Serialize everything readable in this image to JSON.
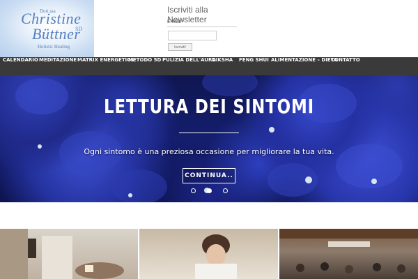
{
  "logo": {
    "title_prefix": "Dott.ssa",
    "name_line1": "Christine",
    "name_line2": "Büttner",
    "suffix": "SD",
    "tagline": "Holistic Healing"
  },
  "newsletter": {
    "title": "Iscriviti alla Newsletter",
    "email_label": "E-Mail *",
    "email_value": "",
    "submit_label": "Iscriviti!"
  },
  "nav": {
    "items": [
      "CALENDARIO",
      "MEDITAZIONE",
      "MATRIX ENERGETICS",
      "METODO 5D",
      "PULIZIA DELL'AURA",
      "DIKSHA",
      "FENG SHUI",
      "ALIMENTAZIONE – DIETA",
      "CONTATTO"
    ]
  },
  "hero": {
    "title": "LETTURA DEI SINTOMI",
    "subtitle": "Ogni sintomo è una preziosa occasione per migliorare la tua vita.",
    "button": "CONTINUA..",
    "slides": 3,
    "active_slide": 2
  },
  "colors": {
    "nav_bg": "#3a3a3a",
    "logo_blue": "#5680bf",
    "hero_blue": "#2533a0"
  }
}
